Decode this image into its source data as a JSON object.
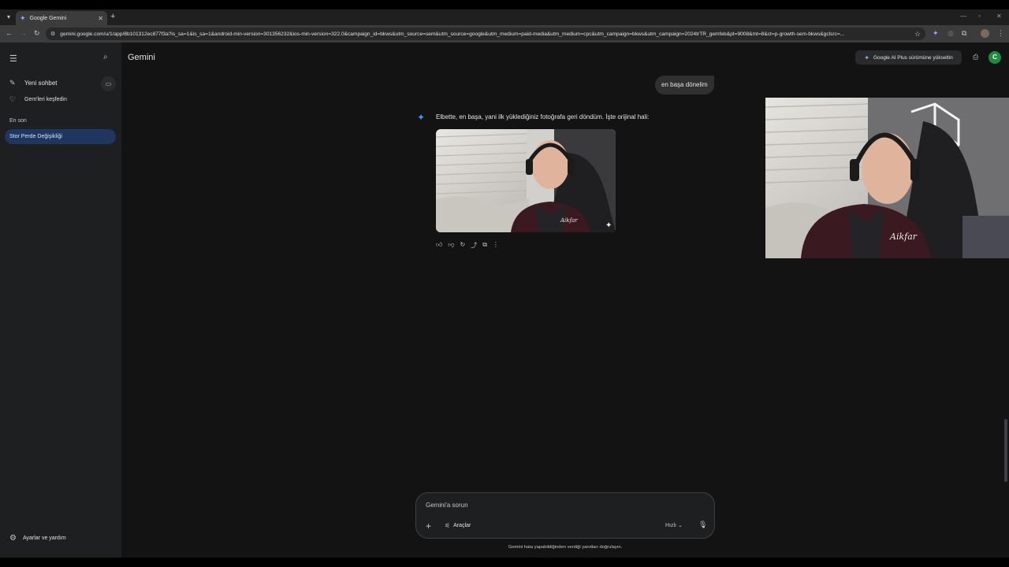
{
  "browser": {
    "tab_title": "Google Gemini",
    "url": "gemini.google.com/u/1/app/8b101312ec877f3a?is_sa=1&is_sa=1&android-min-version=301356232&ios-min-version=322.0&campaign_id=bkws&utm_source=sem&utm_source=google&utm_medium=paid-media&utm_medium=cpc&utm_campaign=bkws&utm_campaign=2024trTR_gemfeb&pt=9008&mt=8&ct=p-growth-sem-bkws&gclsrc=..."
  },
  "sidebar": {
    "new_chat": "Yeni sohbet",
    "explore_gems": "Gem'leri keşfedin",
    "section_recent": "En son",
    "recent_items": [
      "Stor Perde Değişikliği"
    ],
    "settings": "Ayarlar ve yardım"
  },
  "header": {
    "brand": "Gemini",
    "upgrade_button": "Google AI Plus sürümüne yükseltin",
    "avatar_letter": "C"
  },
  "conversation": {
    "user_message": "en başa dönelim",
    "model_reply": "Elbette, en başa, yani ilk yüklediğiniz fotoğrafa geri döndüm. İşte orijinal hali:"
  },
  "composer": {
    "placeholder": "Gemini'a sorun",
    "tools_label": "Araçlar",
    "mode_label": "Hızlı"
  },
  "footer": {
    "disclaimer": "Gemini hata yapabildiğinden verdiği yanıtları doğrulayın."
  },
  "colors": {
    "background": "#131314",
    "sidebar": "#1e1f20",
    "accent": "#4c8df6",
    "recent_selected": "#1f3760",
    "avatar": "#1e8e3e"
  }
}
